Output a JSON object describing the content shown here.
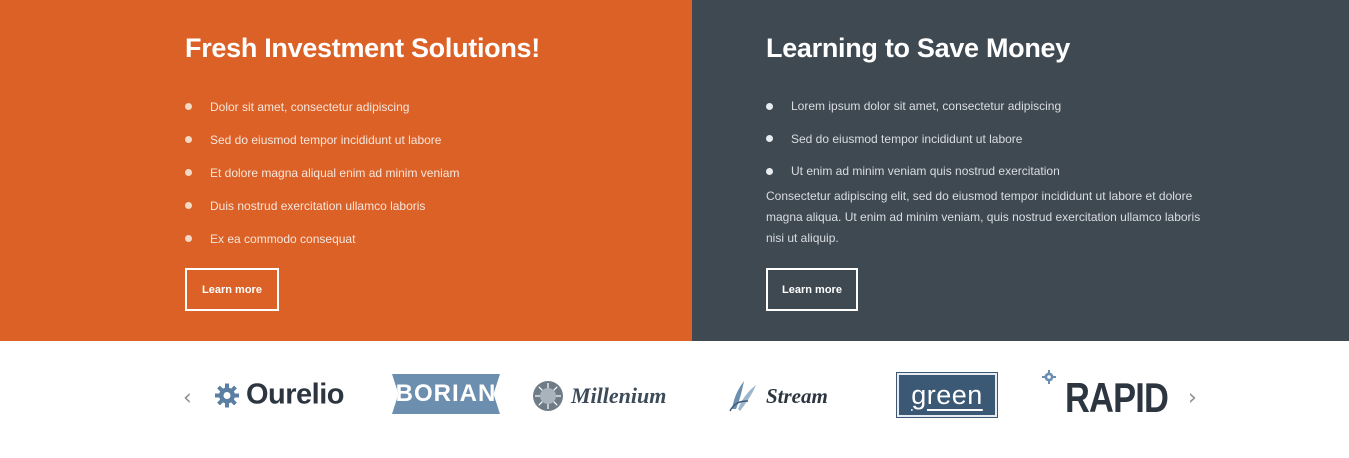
{
  "left_panel": {
    "title": "Fresh Investment Solutions!",
    "items": [
      "Dolor sit amet, consectetur adipiscing",
      "Sed do eiusmod tempor incididunt ut labore",
      "Et dolore magna aliqual enim ad minim veniam",
      "Duis nostrud exercitation ullamco laboris",
      "Ex ea commodo consequat"
    ],
    "button_label": "Learn more",
    "background_color": "#dc6127"
  },
  "right_panel": {
    "title": "Learning to Save Money",
    "items": [
      "Lorem ipsum dolor sit amet, consectetur adipiscing",
      "Sed do eiusmod tempor incididunt ut labore",
      "Ut enim ad minim veniam quis nostrud exercitation"
    ],
    "paragraph": "Consectetur adipiscing elit, sed do eiusmod tempor incididunt ut labore et dolore magna aliqua. Ut enim ad minim veniam, quis nostrud exercitation ullamco laboris nisi ut aliquip.",
    "button_label": "Learn more",
    "background_color": "#3f4952"
  },
  "logos": {
    "prev_arrow": "‹",
    "next_arrow": "›",
    "items": [
      {
        "name": "Ourelio",
        "icon": "gear-icon"
      },
      {
        "name": "BORIAN",
        "icon": "ribbon-badge"
      },
      {
        "name": "Millenium",
        "icon": "sun-icon"
      },
      {
        "name": "Stream",
        "icon": "leaf-icon"
      },
      {
        "name": "green",
        "icon": "box-badge"
      },
      {
        "name": "RAPID",
        "icon": "gear-icon"
      }
    ]
  }
}
